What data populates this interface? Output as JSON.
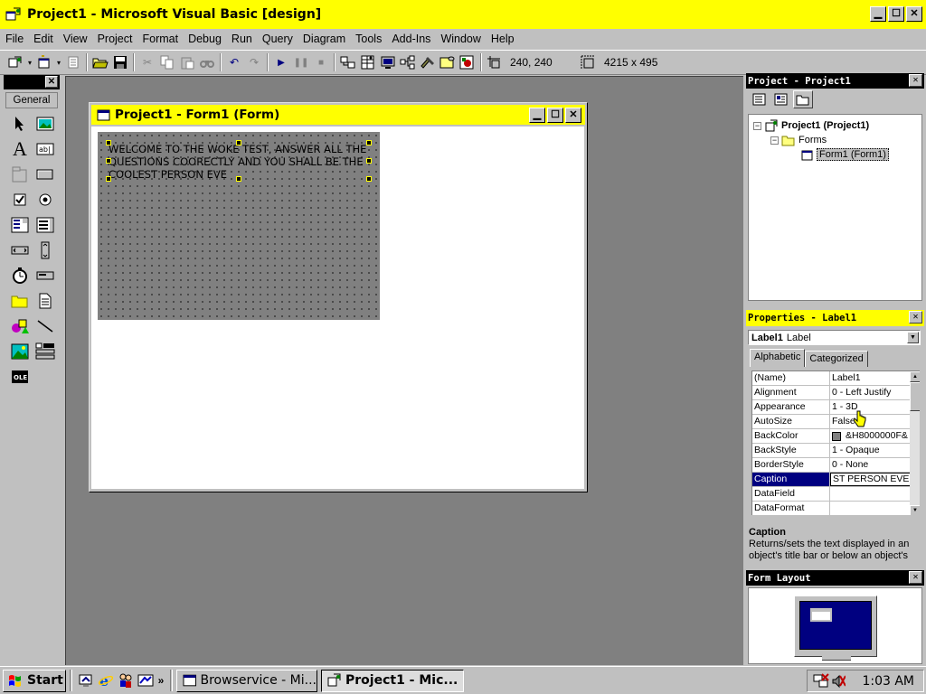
{
  "window": {
    "title": "Project1 - Microsoft Visual Basic [design]",
    "title_bar_color": "#ffff00"
  },
  "menu": [
    "File",
    "Edit",
    "View",
    "Project",
    "Format",
    "Debug",
    "Run",
    "Query",
    "Diagram",
    "Tools",
    "Add-Ins",
    "Window",
    "Help"
  ],
  "toolbar": {
    "position_readout": "240, 240",
    "size_readout": "4215 x 495",
    "icons": [
      "add-project-icon",
      "add-form-icon",
      "menu-editor-icon",
      "open-icon",
      "save-icon",
      "cut-icon",
      "copy-icon",
      "paste-icon",
      "find-icon",
      "undo-icon",
      "redo-icon",
      "start-icon",
      "break-icon",
      "end-icon",
      "project-explorer-icon",
      "properties-window-icon",
      "form-layout-icon",
      "object-browser-icon",
      "toolbox-icon",
      "data-view-icon",
      "component-manager-icon"
    ]
  },
  "toolbox": {
    "tab_label": "General",
    "tools": [
      "pointer",
      "picturebox",
      "label",
      "textbox",
      "frame",
      "commandbutton",
      "checkbox",
      "optionbutton",
      "combobox",
      "listbox",
      "hscrollbar",
      "vscrollbar",
      "timer",
      "drivelistbox",
      "dirlistbox",
      "filelistbox",
      "shape",
      "line",
      "image",
      "data",
      "ole"
    ]
  },
  "form_window": {
    "title": "Project1 - Form1 (Form)",
    "label_caption": "WELCOME TO THE WOKE TEST, ANSWER ALL THE QUESTIONS COORECTLY AND YOU SHALL BE THE COOLEST PERSON EVE"
  },
  "project_panel": {
    "title": "Project - Project1",
    "tree": {
      "root": "Project1 (Project1)",
      "folder": "Forms",
      "item": "Form1 (Form1)"
    }
  },
  "properties_panel": {
    "title": "Properties - Label1",
    "object_name": "Label1",
    "object_type": "Label",
    "tabs": [
      "Alphabetic",
      "Categorized"
    ],
    "active_tab": "Alphabetic",
    "rows": [
      {
        "name": "(Name)",
        "value": "Label1"
      },
      {
        "name": "Alignment",
        "value": "0 - Left Justify"
      },
      {
        "name": "Appearance",
        "value": "1 - 3D"
      },
      {
        "name": "AutoSize",
        "value": "False"
      },
      {
        "name": "BackColor",
        "value": "&H8000000F&",
        "swatch": "#808080"
      },
      {
        "name": "BackStyle",
        "value": "1 - Opaque"
      },
      {
        "name": "BorderStyle",
        "value": "0 - None"
      },
      {
        "name": "Caption",
        "value": "ST PERSON EVE",
        "selected": true
      },
      {
        "name": "DataField",
        "value": ""
      },
      {
        "name": "DataFormat",
        "value": ""
      }
    ],
    "description_title": "Caption",
    "description_text": "Returns/sets the text displayed in an object's title bar or below an object's"
  },
  "layout_panel": {
    "title": "Form Layout"
  },
  "taskbar": {
    "start_label": "Start",
    "quick_launch": [
      "desktop-icon",
      "internet-explorer-icon",
      "people-icon",
      "channels-icon"
    ],
    "overflow": "»",
    "tasks": [
      {
        "label": "Browservice - Mi...",
        "active": false
      },
      {
        "label": "Project1 - Mic...",
        "active": true
      }
    ],
    "clock": "1:03 AM"
  }
}
